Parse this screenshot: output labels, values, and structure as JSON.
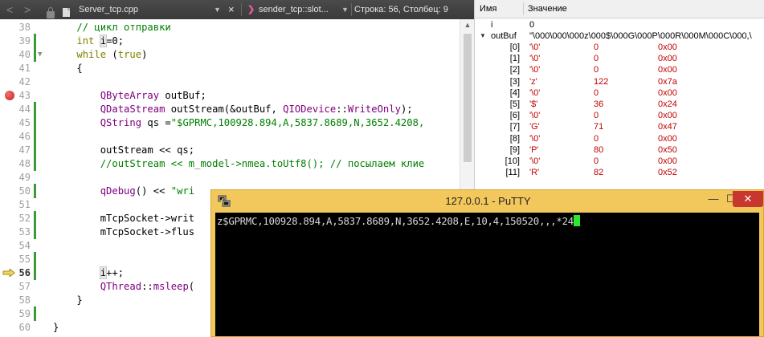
{
  "editor": {
    "toolbar": {
      "back": "<",
      "forward": ">",
      "file_name": "Server_tcp.cpp",
      "close": "×",
      "function_name": "sender_tcp::slot...",
      "position": "Строка: 56, Столбец: 9"
    },
    "lines": [
      {
        "num": "38",
        "code": "    // цикл отправки"
      },
      {
        "num": "39",
        "code": "    int i=0;"
      },
      {
        "num": "40",
        "code": "    while (true)"
      },
      {
        "num": "41",
        "code": "    {"
      },
      {
        "num": "42",
        "code": ""
      },
      {
        "num": "43",
        "code": "        QByteArray outBuf;"
      },
      {
        "num": "44",
        "code": "        QDataStream outStream(&outBuf, QIODevice::WriteOnly);"
      },
      {
        "num": "45",
        "code": "        QString qs =\"$GPRMC,100928.894,A,5837.8689,N,3652.4208,"
      },
      {
        "num": "46",
        "code": ""
      },
      {
        "num": "47",
        "code": "        outStream << qs;"
      },
      {
        "num": "48",
        "code": "        //outStream << m_model->nmea.toUtf8(); // посылаем клие"
      },
      {
        "num": "49",
        "code": ""
      },
      {
        "num": "50",
        "code": "        qDebug() << \"wri"
      },
      {
        "num": "51",
        "code": ""
      },
      {
        "num": "52",
        "code": "        mTcpSocket->writ"
      },
      {
        "num": "53",
        "code": "        mTcpSocket->flus"
      },
      {
        "num": "54",
        "code": ""
      },
      {
        "num": "55",
        "code": ""
      },
      {
        "num": "56",
        "code": "        i++;"
      },
      {
        "num": "57",
        "code": "        QThread::msleep("
      },
      {
        "num": "58",
        "code": "    }"
      },
      {
        "num": "59",
        "code": ""
      },
      {
        "num": "60",
        "code": "}"
      }
    ]
  },
  "locals": {
    "header": {
      "name": "Имя",
      "value": "Значение"
    },
    "var_i": {
      "name": "i",
      "value": "0"
    },
    "var_outbuf": {
      "name": "outBuf",
      "value": "\"\\000\\000\\000z\\000$\\000G\\000P\\000R\\000M\\000C\\000,\\"
    },
    "elements": [
      {
        "index": "[0]",
        "char": "'\\0'",
        "dec": "0",
        "hex": "0x00"
      },
      {
        "index": "[1]",
        "char": "'\\0'",
        "dec": "0",
        "hex": "0x00"
      },
      {
        "index": "[2]",
        "char": "'\\0'",
        "dec": "0",
        "hex": "0x00"
      },
      {
        "index": "[3]",
        "char": "'z'",
        "dec": "122",
        "hex": "0x7a"
      },
      {
        "index": "[4]",
        "char": "'\\0'",
        "dec": "0",
        "hex": "0x00"
      },
      {
        "index": "[5]",
        "char": "'$'",
        "dec": "36",
        "hex": "0x24"
      },
      {
        "index": "[6]",
        "char": "'\\0'",
        "dec": "0",
        "hex": "0x00"
      },
      {
        "index": "[7]",
        "char": "'G'",
        "dec": "71",
        "hex": "0x47"
      },
      {
        "index": "[8]",
        "char": "'\\0'",
        "dec": "0",
        "hex": "0x00"
      },
      {
        "index": "[9]",
        "char": "'P'",
        "dec": "80",
        "hex": "0x50"
      },
      {
        "index": "[10]",
        "char": "'\\0'",
        "dec": "0",
        "hex": "0x00"
      },
      {
        "index": "[11]",
        "char": "'R'",
        "dec": "82",
        "hex": "0x52"
      }
    ]
  },
  "putty": {
    "title": "127.0.0.1 - PuTTY",
    "minimize": "—",
    "maximize": "☐",
    "close": "✕",
    "terminal_text": "z$GPRMC,100928.894,A,5837.8689,N,3652.4208,E,10,4,150520,,,*24"
  },
  "colors": {
    "keyword": "#808000",
    "comment": "#008000",
    "type": "#800080",
    "putty_frame": "#f2c75c",
    "cursor": "#2ee82e"
  }
}
